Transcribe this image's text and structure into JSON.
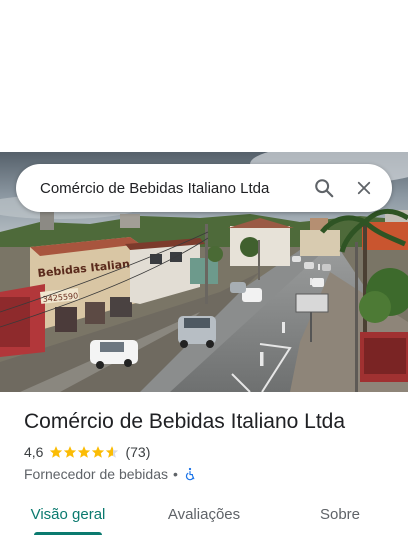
{
  "search": {
    "query": "Comércio de Bebidas Italiano Ltda",
    "search_icon": "search-icon",
    "close_icon": "close-icon"
  },
  "hero": {
    "sign_name": "Bebidas Italiano",
    "sign_phone": "3425590"
  },
  "place": {
    "title": "Comércio de Bebidas Italiano Ltda",
    "rating": "4,6",
    "stars": 4.6,
    "review_count": "(73)",
    "category": "Fornecedor de bebidas",
    "separator": "•",
    "accessibility_icon": "wheelchair-icon"
  },
  "tabs": [
    {
      "label": "Visão geral",
      "active": true
    },
    {
      "label": "Avaliações",
      "active": false
    },
    {
      "label": "Sobre",
      "active": false
    }
  ],
  "colors": {
    "accent": "#0b7a6f",
    "star": "#fbbc04",
    "accessibility": "#1a73e8"
  }
}
